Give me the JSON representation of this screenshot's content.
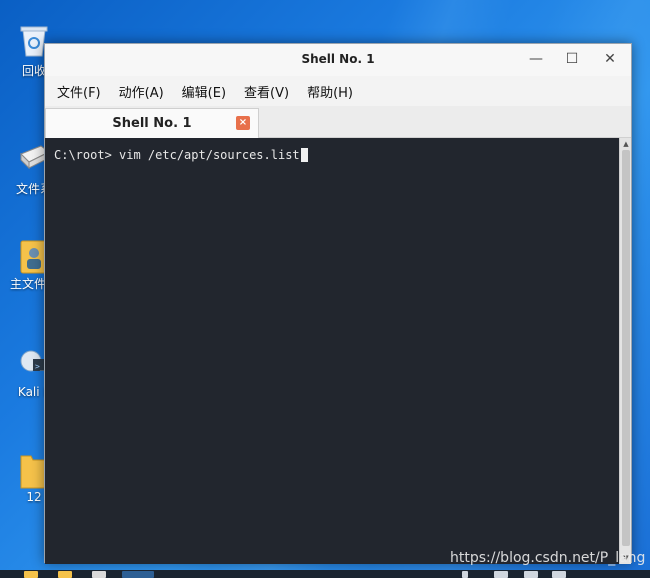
{
  "desktop": {
    "icons": [
      {
        "label": "回收",
        "icon": "recycle-bin-icon"
      },
      {
        "label": "文件系",
        "icon": "drive-icon"
      },
      {
        "label": "主文件夹",
        "icon": "home-folder-icon"
      },
      {
        "label": "Kali L",
        "icon": "kali-icon"
      },
      {
        "label": "12",
        "icon": "folder-icon"
      }
    ]
  },
  "window": {
    "title": "Shell No. 1",
    "controls": {
      "minimize": "—",
      "maximize": "☐",
      "close": "✕"
    },
    "menu": [
      {
        "label": "文件(F)"
      },
      {
        "label": "动作(A)"
      },
      {
        "label": "编辑(E)"
      },
      {
        "label": "查看(V)"
      },
      {
        "label": "帮助(H)"
      }
    ],
    "tab": {
      "label": "Shell No. 1",
      "close": "×"
    }
  },
  "terminal": {
    "prompt": "C:\\root> ",
    "command": "vim /etc/apt/sources.list"
  },
  "watermark": "https://blog.csdn.net/P_lang",
  "colors": {
    "desktop": "#1b7be0",
    "terminal_bg": "#22262e",
    "tab_close": "#e8704b"
  }
}
